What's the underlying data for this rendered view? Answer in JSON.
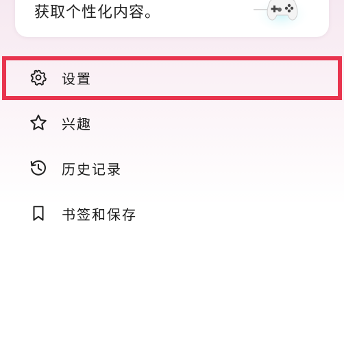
{
  "card": {
    "text": "获取个性化内容。",
    "illustration": "game-controller-icon"
  },
  "menu": {
    "items": [
      {
        "label": "设置",
        "icon": "gear-icon"
      },
      {
        "label": "兴趣",
        "icon": "star-icon"
      },
      {
        "label": "历史记录",
        "icon": "history-icon"
      },
      {
        "label": "书签和保存",
        "icon": "bookmark-icon"
      }
    ]
  },
  "colors": {
    "highlight": "#e8344e",
    "background_top": "#f6e9f1",
    "card": "#ffffff"
  }
}
